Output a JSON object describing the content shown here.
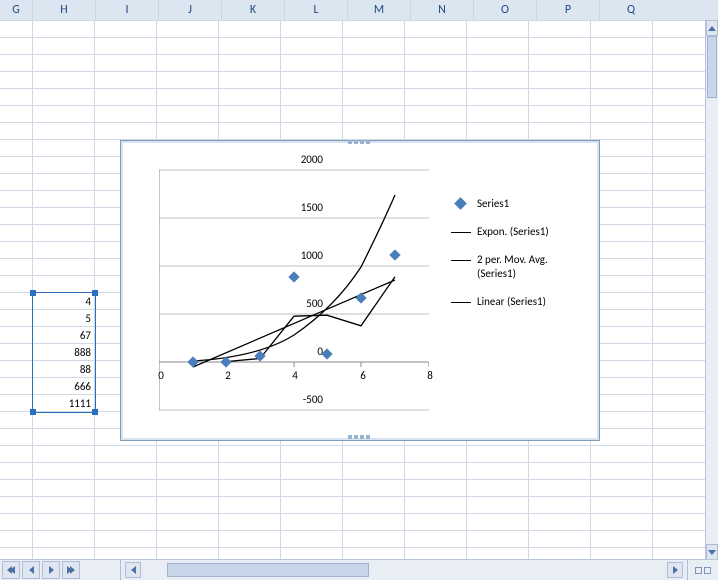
{
  "columns": [
    "G",
    "H",
    "I",
    "J",
    "K",
    "L",
    "M",
    "N",
    "O",
    "P",
    "Q"
  ],
  "selected_values": [
    "4",
    "5",
    "67",
    "888",
    "88",
    "666",
    "1111"
  ],
  "legend": {
    "series": "Series1",
    "expon": "Expon. (Series1)",
    "mavg_l1": "2 per. Mov. Avg.",
    "mavg_l2": "(Series1)",
    "linear": "Linear (Series1)"
  },
  "y_ticks": [
    "2000",
    "1500",
    "1000",
    "500",
    "0",
    "-500"
  ],
  "x_ticks": [
    "0",
    "2",
    "4",
    "6",
    "8"
  ],
  "chart_data": {
    "type": "scatter",
    "x": [
      1,
      2,
      3,
      4,
      5,
      6,
      7
    ],
    "values": [
      4,
      5,
      67,
      888,
      88,
      666,
      1111
    ],
    "series": [
      {
        "name": "Series1",
        "type": "scatter",
        "values": [
          4,
          5,
          67,
          888,
          88,
          666,
          1111
        ]
      },
      {
        "name": "Expon. (Series1)",
        "type": "line_fit",
        "kind": "exponential"
      },
      {
        "name": "2 per. Mov. Avg. (Series1)",
        "type": "line_fit",
        "kind": "moving_average",
        "period": 2
      },
      {
        "name": "Linear (Series1)",
        "type": "line_fit",
        "kind": "linear"
      }
    ],
    "xlabel": "",
    "ylabel": "",
    "xlim": [
      0,
      8
    ],
    "ylim": [
      -500,
      2000
    ],
    "title": ""
  },
  "colors": {
    "marker": "#4a7ebb",
    "grid": "#d0d7e5",
    "header": "#dce6f1",
    "sel": "#2a6fbb"
  }
}
